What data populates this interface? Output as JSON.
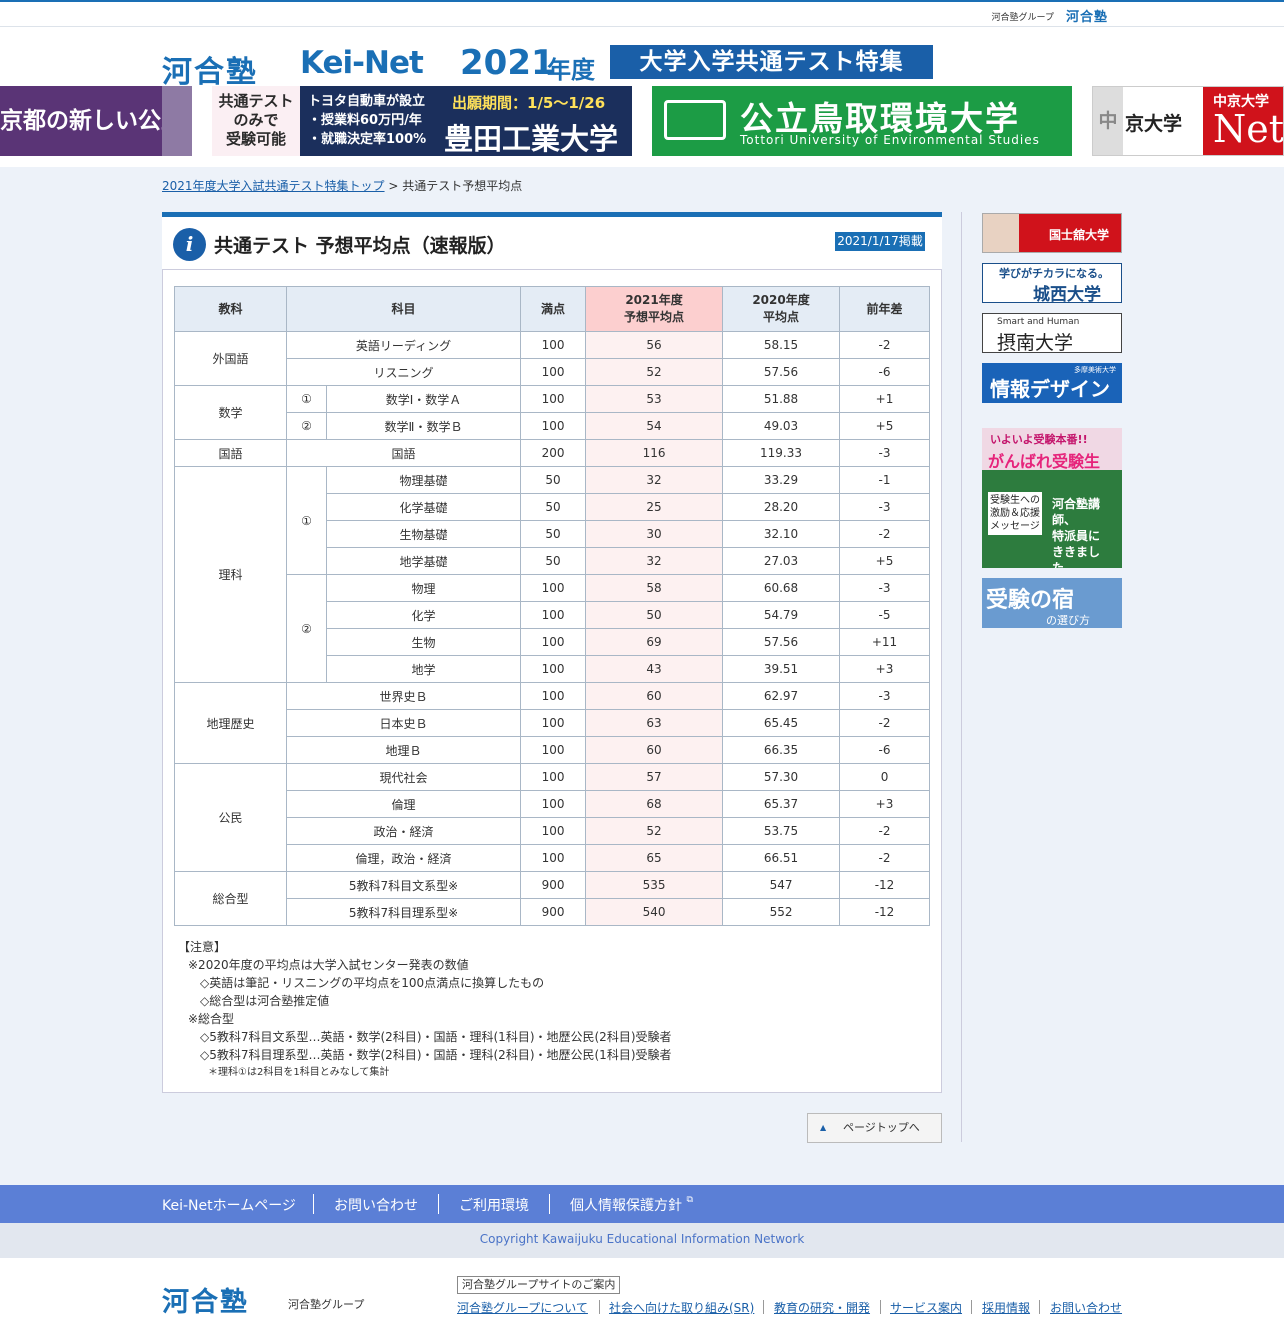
{
  "topbar": {
    "group_label": "河合塾グループ",
    "logo": "河合塾"
  },
  "header": {
    "kawai": "河合塾",
    "keinet": "Kei-Net",
    "year": "2021",
    "year_suffix": "年度",
    "feature": "大学入学共通テスト特集"
  },
  "banners": {
    "b1": "京都の新しい公立大学",
    "b2_left": [
      "共通テスト",
      "のみで",
      "受験可能"
    ],
    "b2_mid": [
      "トヨタ自動車が設立",
      "・授業料60万円/年",
      "・就職決定率100%"
    ],
    "b2_period": "出願期間：1/5～1/26",
    "b2_name": "豊田工業大学",
    "b3_jp": "公立鳥取環境大学",
    "b3_en": "Tottori University of Environmental Studies",
    "b4_gray": "中",
    "b4_name": "京大学",
    "b4_red_title": "中京大学",
    "b4_red_net": "Net"
  },
  "breadcrumb": {
    "link": "2021年度大学入試共通テスト特集トップ",
    "sep": ">",
    "current": "共通テスト予想平均点"
  },
  "page": {
    "title": "共通テスト 予想平均点（速報版）",
    "date": "2021/1/17掲載"
  },
  "table": {
    "headers": {
      "subject": "教科",
      "course": "科目",
      "full": "満点",
      "pred_1": "2021年度",
      "pred_2": "予想平均点",
      "prev_1": "2020年度",
      "prev_2": "平均点",
      "diff": "前年差"
    },
    "rows": [
      {
        "cat": "外国語",
        "sub": "",
        "course": "英語リーディング",
        "full": "100",
        "pred": "56",
        "prev": "58.15",
        "diff": "-2"
      },
      {
        "cat": "",
        "sub": "",
        "course": "リスニング",
        "full": "100",
        "pred": "52",
        "prev": "57.56",
        "diff": "-6"
      },
      {
        "cat": "数学",
        "sub": "①",
        "course": "数学Ⅰ・数学Ａ",
        "full": "100",
        "pred": "53",
        "prev": "51.88",
        "diff": "+1"
      },
      {
        "cat": "",
        "sub": "②",
        "course": "数学Ⅱ・数学Ｂ",
        "full": "100",
        "pred": "54",
        "prev": "49.03",
        "diff": "+5"
      },
      {
        "cat": "国語",
        "sub": "",
        "course": "国語",
        "full": "200",
        "pred": "116",
        "prev": "119.33",
        "diff": "-3"
      },
      {
        "cat": "理科",
        "sub": "①",
        "course": "物理基礎",
        "full": "50",
        "pred": "32",
        "prev": "33.29",
        "diff": "-1"
      },
      {
        "cat": "",
        "sub": "",
        "course": "化学基礎",
        "full": "50",
        "pred": "25",
        "prev": "28.20",
        "diff": "-3"
      },
      {
        "cat": "",
        "sub": "",
        "course": "生物基礎",
        "full": "50",
        "pred": "30",
        "prev": "32.10",
        "diff": "-2"
      },
      {
        "cat": "",
        "sub": "",
        "course": "地学基礎",
        "full": "50",
        "pred": "32",
        "prev": "27.03",
        "diff": "+5"
      },
      {
        "cat": "",
        "sub": "②",
        "course": "物理",
        "full": "100",
        "pred": "58",
        "prev": "60.68",
        "diff": "-3"
      },
      {
        "cat": "",
        "sub": "",
        "course": "化学",
        "full": "100",
        "pred": "50",
        "prev": "54.79",
        "diff": "-5"
      },
      {
        "cat": "",
        "sub": "",
        "course": "生物",
        "full": "100",
        "pred": "69",
        "prev": "57.56",
        "diff": "+11"
      },
      {
        "cat": "",
        "sub": "",
        "course": "地学",
        "full": "100",
        "pred": "43",
        "prev": "39.51",
        "diff": "+3"
      },
      {
        "cat": "地理歴史",
        "sub": "",
        "course": "世界史Ｂ",
        "full": "100",
        "pred": "60",
        "prev": "62.97",
        "diff": "-3"
      },
      {
        "cat": "",
        "sub": "",
        "course": "日本史Ｂ",
        "full": "100",
        "pred": "63",
        "prev": "65.45",
        "diff": "-2"
      },
      {
        "cat": "",
        "sub": "",
        "course": "地理Ｂ",
        "full": "100",
        "pred": "60",
        "prev": "66.35",
        "diff": "-6"
      },
      {
        "cat": "公民",
        "sub": "",
        "course": "現代社会",
        "full": "100",
        "pred": "57",
        "prev": "57.30",
        "diff": "0"
      },
      {
        "cat": "",
        "sub": "",
        "course": "倫理",
        "full": "100",
        "pred": "68",
        "prev": "65.37",
        "diff": "+3"
      },
      {
        "cat": "",
        "sub": "",
        "course": "政治・経済",
        "full": "100",
        "pred": "52",
        "prev": "53.75",
        "diff": "-2"
      },
      {
        "cat": "",
        "sub": "",
        "course": "倫理，政治・経済",
        "full": "100",
        "pred": "65",
        "prev": "66.51",
        "diff": "-2"
      },
      {
        "cat": "総合型",
        "sub": "",
        "course": "5教科7科目文系型※",
        "full": "900",
        "pred": "535",
        "prev": "547",
        "diff": "-12"
      },
      {
        "cat": "",
        "sub": "",
        "course": "5教科7科目理系型※",
        "full": "900",
        "pred": "540",
        "prev": "552",
        "diff": "-12"
      }
    ]
  },
  "notes": {
    "head": "【注意】",
    "l1": "※2020年度の平均点は大学入試センター発表の数値",
    "l2": "◇英語は筆記・リスニングの平均点を100点満点に換算したもの",
    "l3": "◇総合型は河合塾推定値",
    "l4": "※総合型",
    "l5": "◇5教科7科目文系型…英語・数学(2科目)・国語・理科(1科目)・地歴公民(2科目)受験者",
    "l6": "◇5教科7科目理系型…英語・数学(2科目)・国語・理科(2科目)・地歴公民(1科目)受験者",
    "l7": "＊理科①は2科目を1科目とみなして集計"
  },
  "pagetop": "ページトップへ",
  "sidebar": {
    "s1": "国士舘大学",
    "s2_slogan": "学びがチカラになる。",
    "s2_name": "城西大学",
    "s3_slogan": "Smart and Human",
    "s3_name": "摂南大学",
    "s4_small": "多摩美術大学",
    "s4_name": "情報デザイン",
    "s5_t1": "いよいよ受験本番!!",
    "s5_t2": "がんばれ受験生",
    "s5_t3": [
      "河合塾講師、",
      "特派員に",
      "ききました。"
    ],
    "s5_t4": [
      "受験生への",
      "激励＆応援",
      "メッセージ"
    ],
    "s6_name": "受験の宿",
    "s6_small": "の選び方"
  },
  "footer": {
    "nav": [
      "Kei-Netホームページ",
      "お問い合わせ",
      "ご利用環境",
      "個人情報保護方針"
    ],
    "copyright": "Copyright Kawaijuku Educational Information Network",
    "logo": "河合塾",
    "group": "河合塾グループ",
    "guide": "河合塾グループサイトのご案内",
    "links": [
      "河合塾グループについて",
      "社会へ向けた取り組み(SR)",
      "教育の研究・開発",
      "サービス案内",
      "採用情報",
      "お問い合わせ"
    ]
  }
}
